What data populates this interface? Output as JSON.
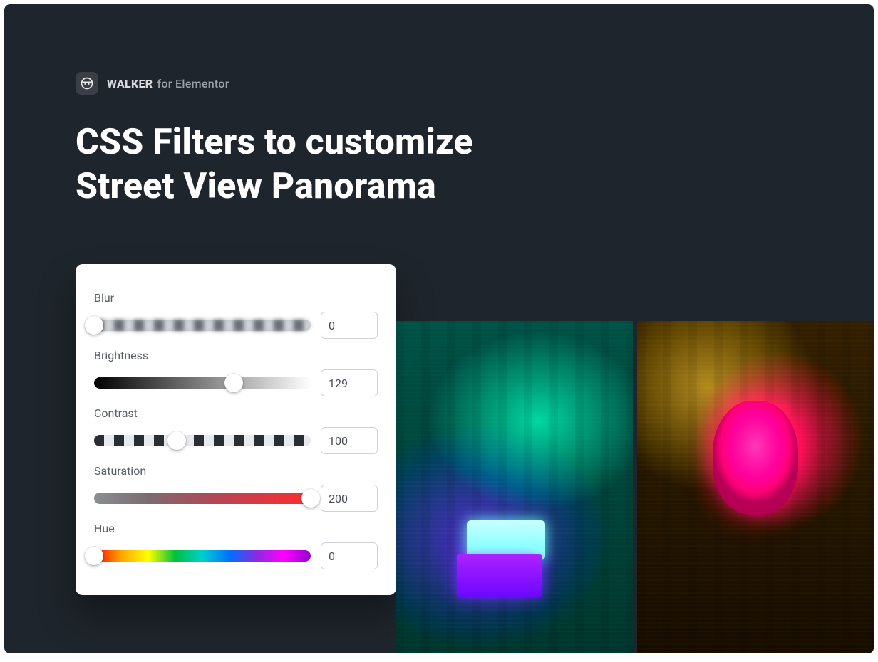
{
  "brand": {
    "bold": "WALKER",
    "regular": "for Elementor"
  },
  "title_line1": "CSS Filters to customize",
  "title_line2": "Street View Panorama",
  "filters": {
    "blur": {
      "label": "Blur",
      "value": "0",
      "min": 0,
      "max": 20,
      "thumb_pct": 0
    },
    "brightness": {
      "label": "Brightness",
      "value": "129",
      "min": 0,
      "max": 200,
      "thumb_pct": 64.5
    },
    "contrast": {
      "label": "Contrast",
      "value": "100",
      "min": 0,
      "max": 200,
      "thumb_pct": 38
    },
    "saturation": {
      "label": "Saturation",
      "value": "200",
      "min": 0,
      "max": 200,
      "thumb_pct": 100
    },
    "hue": {
      "label": "Hue",
      "value": "0",
      "min": 0,
      "max": 360,
      "thumb_pct": 0
    }
  }
}
